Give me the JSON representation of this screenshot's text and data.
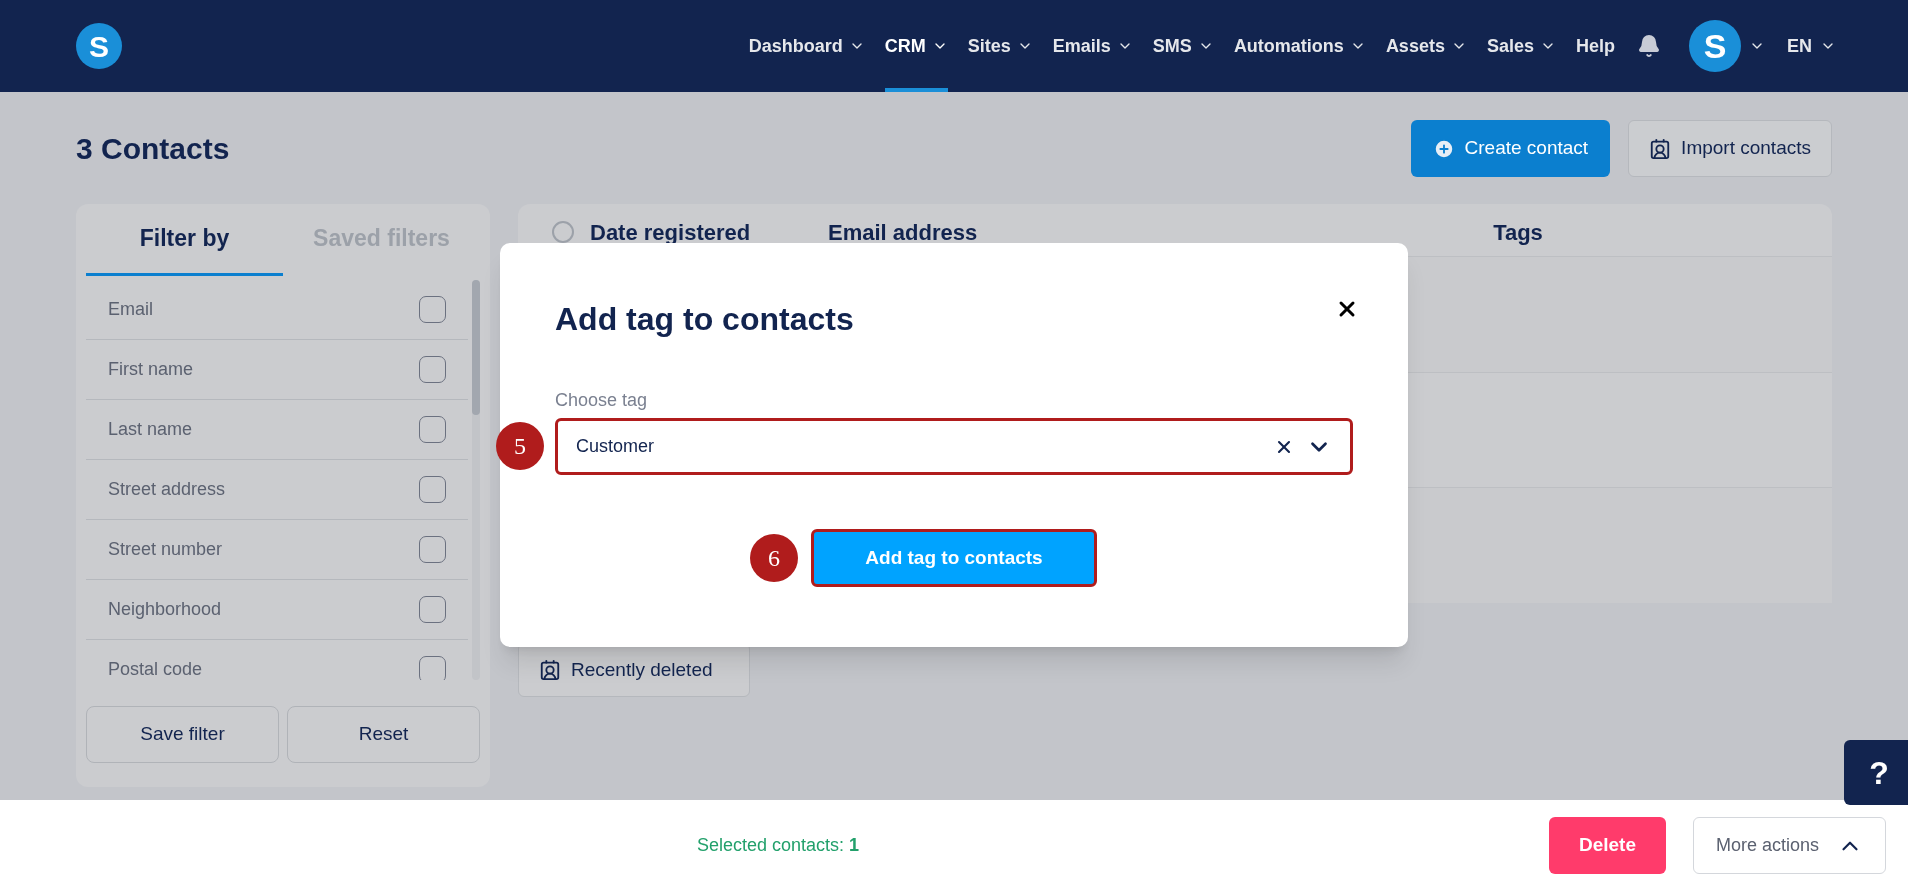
{
  "nav": {
    "logo": "S",
    "items": [
      {
        "label": "Dashboard",
        "selected": false,
        "dropdown": true
      },
      {
        "label": "CRM",
        "selected": true,
        "dropdown": true
      },
      {
        "label": "Sites",
        "selected": false,
        "dropdown": true
      },
      {
        "label": "Emails",
        "selected": false,
        "dropdown": true
      },
      {
        "label": "SMS",
        "selected": false,
        "dropdown": true
      },
      {
        "label": "Automations",
        "selected": false,
        "dropdown": true
      },
      {
        "label": "Assets",
        "selected": false,
        "dropdown": true
      },
      {
        "label": "Sales",
        "selected": false,
        "dropdown": true
      },
      {
        "label": "Help",
        "selected": false,
        "dropdown": false
      }
    ],
    "avatar": "S",
    "language": "EN"
  },
  "page": {
    "title": "3 Contacts",
    "actions": [
      {
        "label": "Create contact",
        "kind": "primary"
      },
      {
        "label": "Import contacts",
        "kind": "secondary"
      }
    ]
  },
  "filters": {
    "tabs": [
      {
        "label": "Filter by",
        "selected": true
      },
      {
        "label": "Saved filters",
        "selected": false
      }
    ],
    "items": [
      {
        "label": "Email",
        "checked": false
      },
      {
        "label": "First name",
        "checked": false
      },
      {
        "label": "Last name",
        "checked": false
      },
      {
        "label": "Street address",
        "checked": false
      },
      {
        "label": "Street number",
        "checked": false
      },
      {
        "label": "Neighborhood",
        "checked": false
      },
      {
        "label": "Postal code",
        "checked": false
      }
    ],
    "buttons": [
      "Save filter",
      "Reset"
    ]
  },
  "table": {
    "all_selected": false,
    "columns": [
      "Date registered",
      "Email address",
      "Tags"
    ]
  },
  "recently_deleted": "Recently deleted",
  "modal": {
    "title": "Add tag to contacts",
    "field_label": "Choose tag",
    "value": "Customer",
    "submit": "Add tag to contacts",
    "markers": [
      "5",
      "6"
    ]
  },
  "footer": {
    "selected_label": "Selected contacts:",
    "selected_count": "1",
    "buttons": [
      {
        "label": "Delete",
        "kind": "danger"
      },
      {
        "label": "More actions",
        "kind": "menu"
      }
    ]
  },
  "help": "?"
}
